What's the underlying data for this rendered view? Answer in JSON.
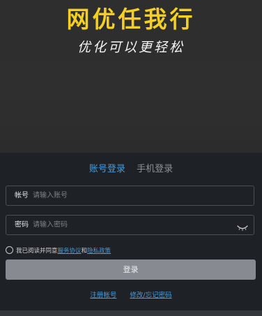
{
  "banner": {
    "title": "网优任我行",
    "slogan": "优化可以更轻松",
    "title_color": "#f5d023"
  },
  "tabs": [
    {
      "label": "账号登录",
      "active": true
    },
    {
      "label": "手机登录",
      "active": false
    }
  ],
  "form": {
    "account": {
      "label": "帐号",
      "placeholder": "请输入账号",
      "value": ""
    },
    "password": {
      "label": "密码",
      "placeholder": "请输入密码",
      "value": "",
      "toggle_icon": "eye-closed-icon"
    }
  },
  "agreement": {
    "prefix": "我已阅读并同意",
    "service_link": "服务协议",
    "and": "和",
    "privacy_link": "隐私政策",
    "checked": false
  },
  "login_button": {
    "label": "登录"
  },
  "links": {
    "register": "注册帐号",
    "reset_password": "修改/忘记密码"
  },
  "colors": {
    "accent": "#4a9bd9",
    "panel_bg": "#1e2126",
    "banner_bg": "#2e2e2e",
    "button_bg": "#878b91"
  }
}
